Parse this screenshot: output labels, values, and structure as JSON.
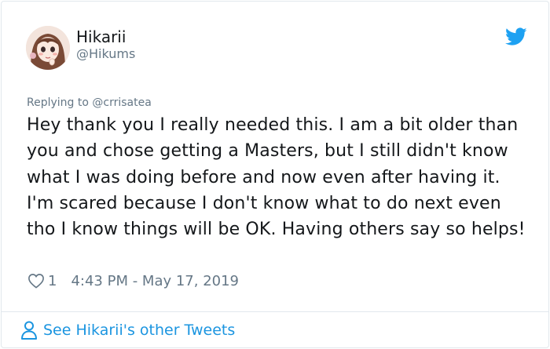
{
  "tweet": {
    "author": {
      "display_name": "Hikarii",
      "handle": "@Hikums",
      "avatar_icon": "anime-girl-avatar"
    },
    "reply_context": {
      "prefix": "Replying to",
      "mention": "@crrisatea"
    },
    "text": "Hey thank you I really needed this. I am a bit older than you and chose getting a Masters, but I still didn't know what I was doing before and now even after having it. I'm scared because I don't know what to do next even tho I know things will be OK. Having others say so helps!",
    "likes": "1",
    "timestamp": "4:43 PM - May 17, 2019",
    "platform_icon": "twitter-bird-icon"
  },
  "footer": {
    "see_more_label": "See Hikarii's other Tweets",
    "icon": "person-icon"
  },
  "colors": {
    "brand": "#1da1f2",
    "link": "#1b95e0",
    "secondary_text": "#657786",
    "primary_text": "#14171a",
    "border": "#e1e8ed"
  }
}
